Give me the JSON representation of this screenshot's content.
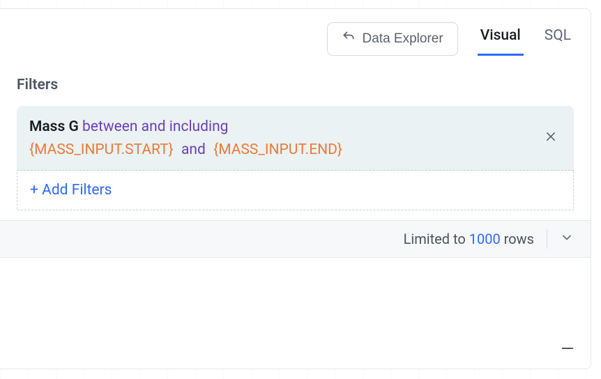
{
  "header": {
    "back_label": "Data Explorer",
    "tabs": [
      {
        "label": "Visual",
        "active": true
      },
      {
        "label": "SQL",
        "active": false
      }
    ]
  },
  "filters": {
    "section_title": "Filters",
    "add_label": "+ Add Filters",
    "items": [
      {
        "field": "Mass G",
        "operator": "between and including",
        "param_start": "{MASS_INPUT.START}",
        "conjunction": "and",
        "param_end": "{MASS_INPUT.END}"
      }
    ]
  },
  "limit": {
    "prefix": "Limited to",
    "value": "1000",
    "suffix": "rows"
  }
}
